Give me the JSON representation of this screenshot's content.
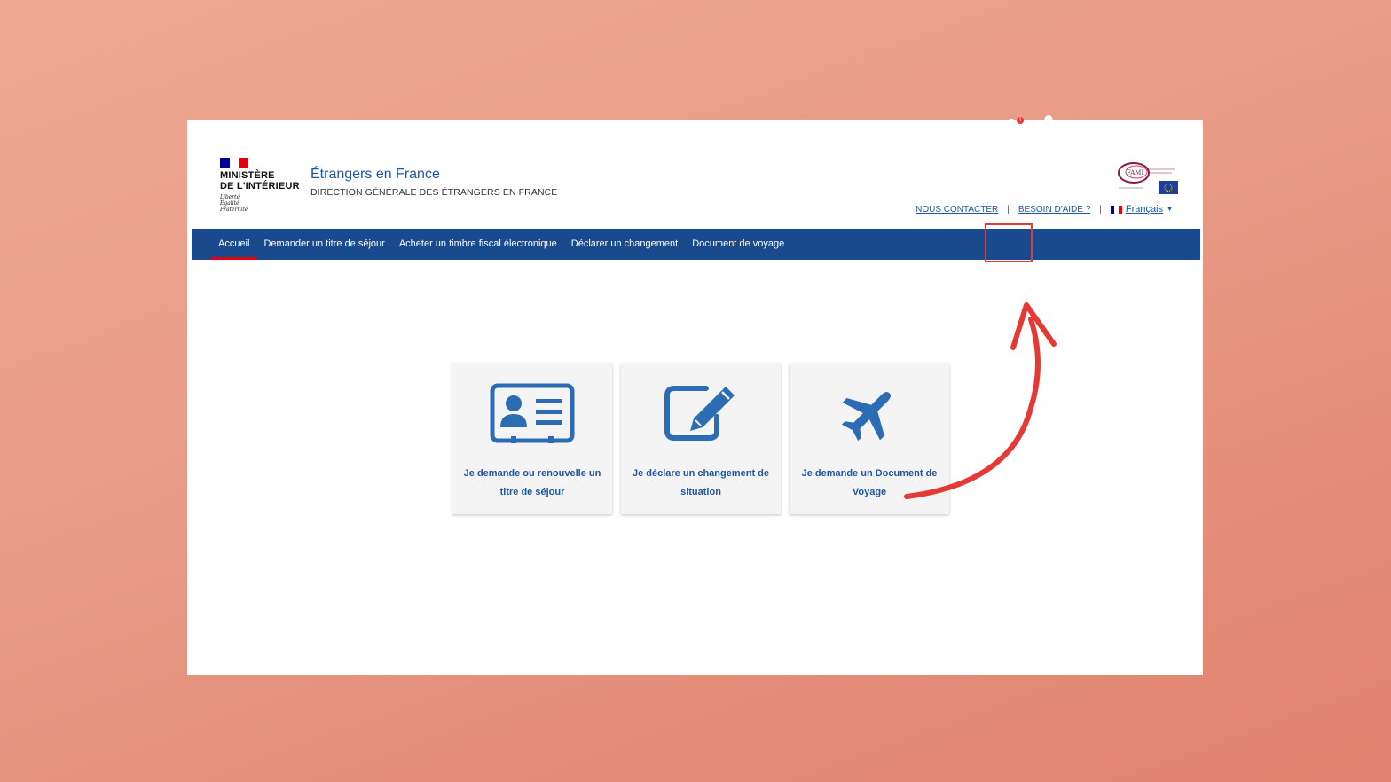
{
  "header": {
    "ministry_line1": "MINISTÈRE",
    "ministry_line2": "DE L'INTÉRIEUR",
    "motto_line1": "Liberté",
    "motto_line2": "Égalité",
    "motto_line3": "Fraternité",
    "site_title": "Étrangers en France",
    "site_subtitle": "DIRECTION GÉNÉRALE DES ÉTRANGERS EN FRANCE",
    "fami_label": "FAMI"
  },
  "top_links": {
    "contact": "NOUS CONTACTER",
    "separator": "|",
    "help": "BESOIN D'AIDE ?",
    "language": "Français"
  },
  "nav": {
    "items": [
      {
        "label": "Accueil",
        "active": true
      },
      {
        "label": "Demander un titre de séjour",
        "active": false
      },
      {
        "label": "Acheter un timbre fiscal électronique",
        "active": false
      },
      {
        "label": "Déclarer un changement",
        "active": false
      },
      {
        "label": "Document de voyage",
        "active": false
      }
    ],
    "notification_count": "1"
  },
  "cards": [
    {
      "label": "Je demande ou renouvelle un titre de séjour",
      "icon": "id-card-icon"
    },
    {
      "label": "Je déclare un changement de situation",
      "icon": "edit-icon"
    },
    {
      "label": "Je demande un Document de Voyage",
      "icon": "airplane-icon"
    }
  ],
  "colors": {
    "brand_blue": "#194a8e",
    "link_blue": "#1f56a3",
    "accent_red": "#e53935",
    "card_bg": "#f4f4f4",
    "french_blue": "#000091",
    "french_red": "#e1000f"
  }
}
